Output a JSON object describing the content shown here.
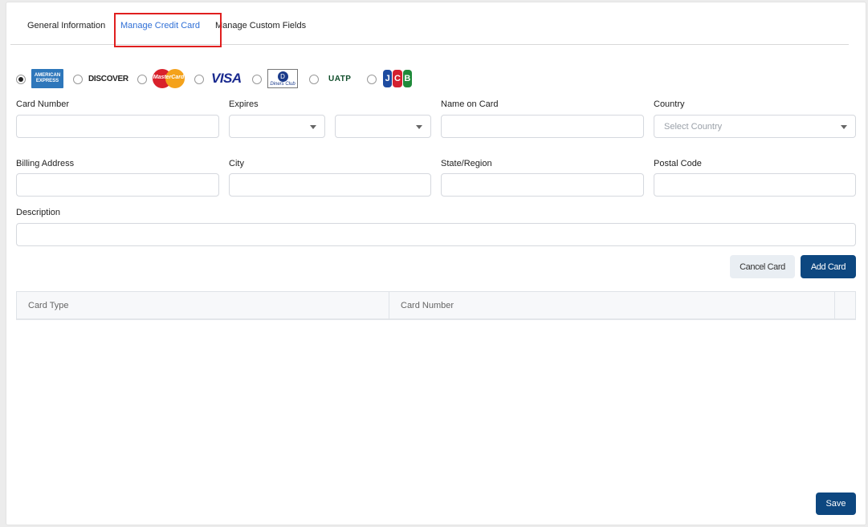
{
  "tabs": [
    {
      "label": "General Information",
      "active": false
    },
    {
      "label": "Manage Credit Card",
      "active": true
    },
    {
      "label": "Manage Custom Fields",
      "active": false
    }
  ],
  "card_types": [
    {
      "name": "American Express",
      "icon": "amex-logo",
      "selected": true,
      "logo_text": [
        "AMERICAN",
        "EXPRESS"
      ]
    },
    {
      "name": "Discover",
      "icon": "discover-logo",
      "selected": false,
      "logo_text": "DISCOVER"
    },
    {
      "name": "MasterCard",
      "icon": "mastercard-logo",
      "selected": false,
      "logo_text": "MasterCard"
    },
    {
      "name": "Visa",
      "icon": "visa-logo",
      "selected": false,
      "logo_text": "VISA"
    },
    {
      "name": "Diners Club",
      "icon": "diners-club-logo",
      "selected": false,
      "logo_text": "Diners Club"
    },
    {
      "name": "UATP",
      "icon": "uatp-logo",
      "selected": false,
      "logo_text": "UATP"
    },
    {
      "name": "JCB",
      "icon": "jcb-logo",
      "selected": false,
      "logo_text": [
        "J",
        "C",
        "B"
      ]
    }
  ],
  "form": {
    "card_number": {
      "label": "Card Number",
      "value": ""
    },
    "expires": {
      "label": "Expires",
      "month": "",
      "year": ""
    },
    "name_on_card": {
      "label": "Name on Card",
      "value": ""
    },
    "country": {
      "label": "Country",
      "placeholder": "Select Country"
    },
    "billing_address": {
      "label": "Billing Address",
      "value": ""
    },
    "city": {
      "label": "City",
      "value": ""
    },
    "state_region": {
      "label": "State/Region",
      "value": ""
    },
    "postal_code": {
      "label": "Postal Code",
      "value": ""
    },
    "description": {
      "label": "Description",
      "value": ""
    }
  },
  "buttons": {
    "cancel_card": "Cancel Card",
    "add_card": "Add Card",
    "save": "Save"
  },
  "table": {
    "columns": [
      "Card Type",
      "Card Number",
      ""
    ],
    "rows": []
  },
  "colors": {
    "active_tab": "#2f6fd6",
    "primary_button": "#0d4780",
    "highlight_box": "#e01f1f"
  }
}
